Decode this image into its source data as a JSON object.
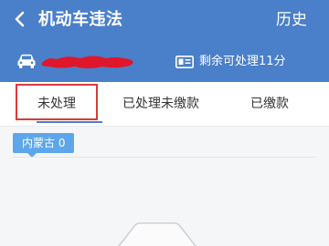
{
  "header": {
    "title": "机动车违法",
    "history_label": "历史",
    "remaining_text": "剩余可处理11分"
  },
  "tabs": [
    {
      "label": "未处理",
      "active": true
    },
    {
      "label": "已处理未缴款",
      "active": false
    },
    {
      "label": "已缴款",
      "active": false
    }
  ],
  "region_chip": {
    "label": "内蒙古 0"
  },
  "colors": {
    "header_blue": "#4a7fc9",
    "chip_blue": "#5ea6ea",
    "highlight_red": "#d93b3b",
    "redaction_red": "#e0162b"
  },
  "icons": [
    "back-icon",
    "car-icon",
    "license-icon",
    "empty-state-icon"
  ]
}
